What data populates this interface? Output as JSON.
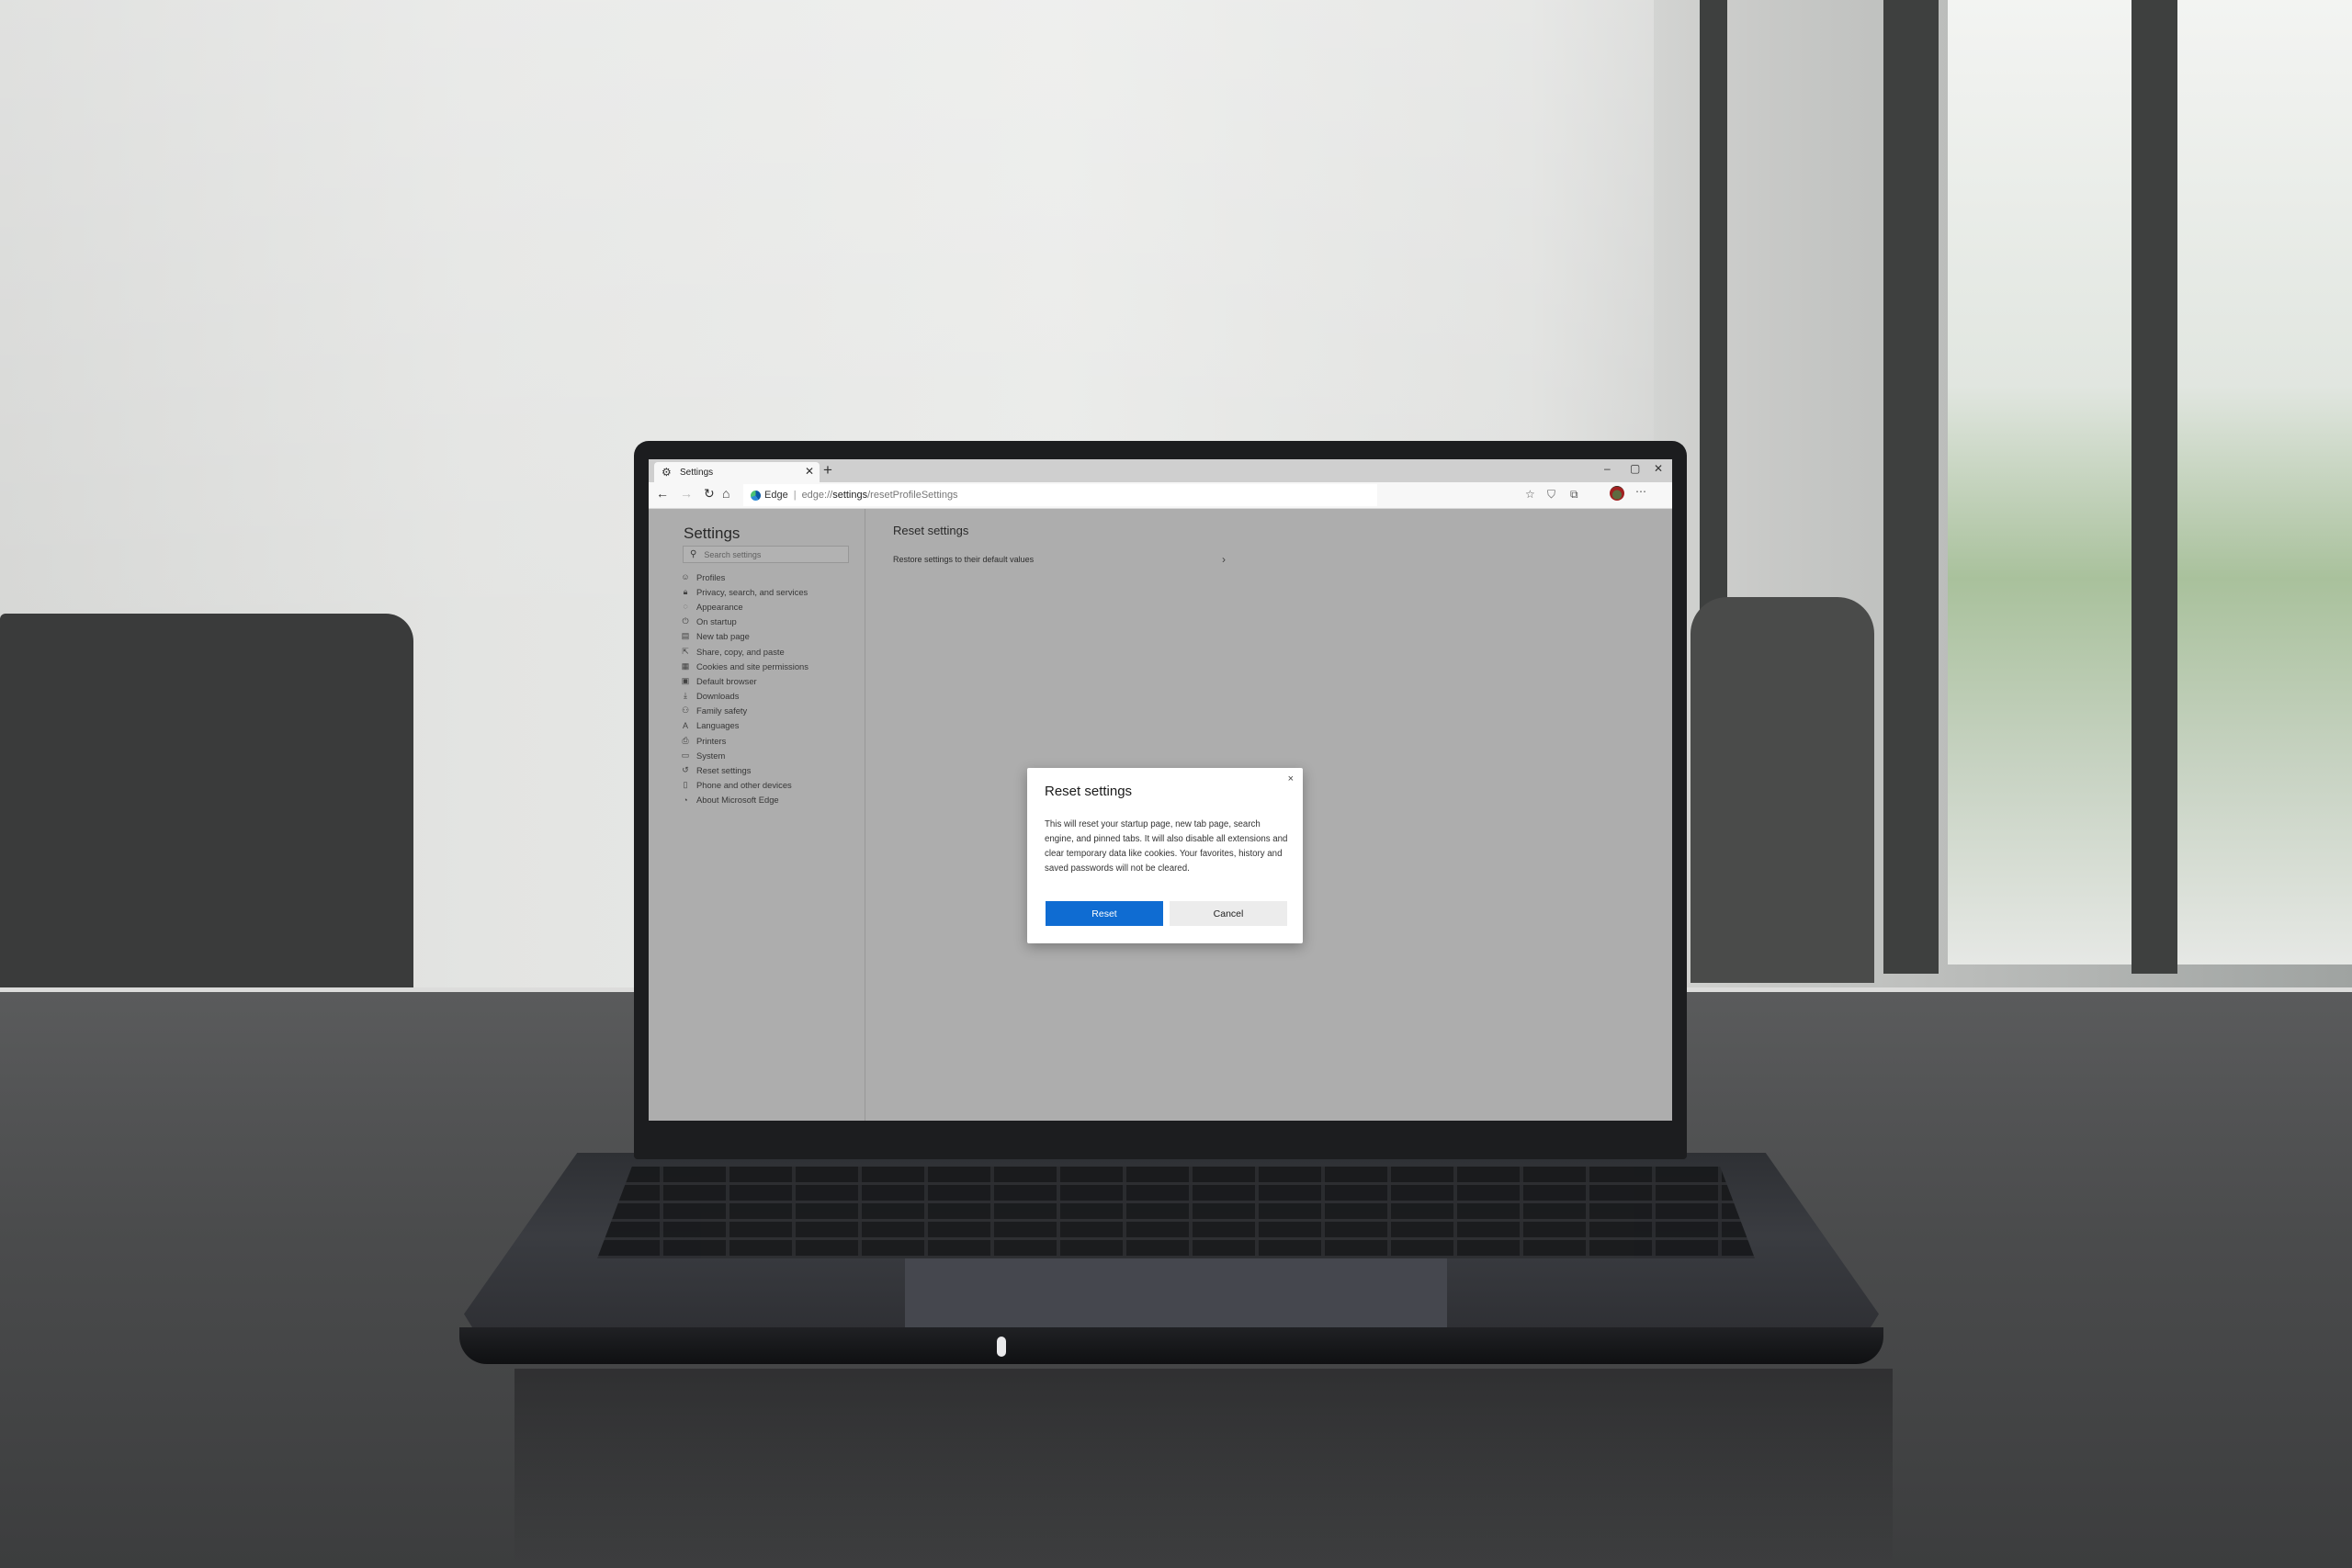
{
  "browser": {
    "tab": {
      "title": "Settings",
      "icon": "gear-icon"
    },
    "new_tab_label": "+",
    "window_controls": {
      "minimize": "–",
      "restore": "▢",
      "close": "✕"
    },
    "address_bar": {
      "site_label": "Edge",
      "separator": "|",
      "url_prefix": "edge://",
      "url_strong": "settings",
      "url_suffix": "/resetProfileSettings"
    },
    "toolbar_icons": [
      "favorites-icon",
      "tracking-prevention-icon",
      "collections-icon",
      "profile-avatar",
      "more-menu-icon"
    ]
  },
  "sidebar": {
    "title": "Settings",
    "search_placeholder": "Search settings",
    "items": [
      {
        "label": "Profiles",
        "icon": "profile-icon"
      },
      {
        "label": "Privacy, search, and services",
        "icon": "lock-icon"
      },
      {
        "label": "Appearance",
        "icon": "palette-icon"
      },
      {
        "label": "On startup",
        "icon": "power-icon"
      },
      {
        "label": "New tab page",
        "icon": "new-tab-icon"
      },
      {
        "label": "Share, copy, and paste",
        "icon": "share-icon"
      },
      {
        "label": "Cookies and site permissions",
        "icon": "cookie-permissions-icon"
      },
      {
        "label": "Default browser",
        "icon": "default-browser-icon"
      },
      {
        "label": "Downloads",
        "icon": "download-icon"
      },
      {
        "label": "Family safety",
        "icon": "family-icon"
      },
      {
        "label": "Languages",
        "icon": "languages-icon"
      },
      {
        "label": "Printers",
        "icon": "printer-icon"
      },
      {
        "label": "System",
        "icon": "laptop-icon"
      },
      {
        "label": "Reset settings",
        "icon": "reset-icon"
      },
      {
        "label": "Phone and other devices",
        "icon": "phone-icon"
      },
      {
        "label": "About Microsoft Edge",
        "icon": "edge-logo-icon"
      }
    ]
  },
  "main": {
    "title": "Reset settings",
    "row_label": "Restore settings to their default values"
  },
  "dialog": {
    "title": "Reset settings",
    "body": "This will reset your startup page, new tab page, search engine, and pinned tabs. It will also disable all extensions and clear temporary data like cookies. Your favorites, history and saved passwords will not be cleared.",
    "primary_button": "Reset",
    "secondary_button": "Cancel",
    "close_label": "×",
    "accent_color": "#0F6CD2"
  }
}
